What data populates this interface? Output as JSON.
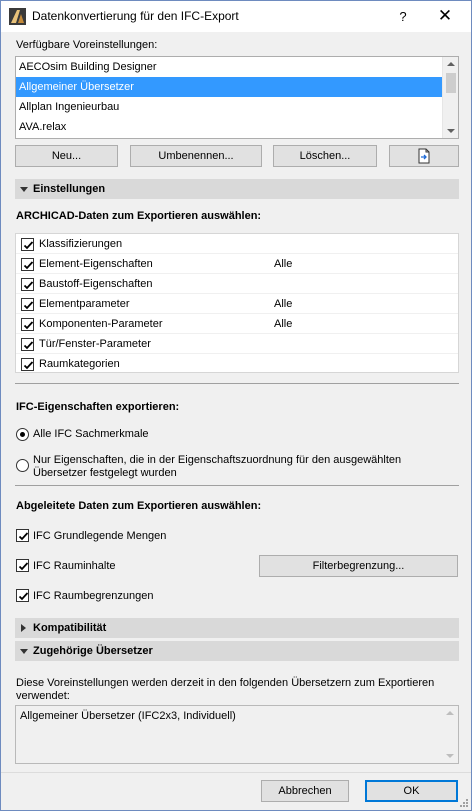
{
  "window": {
    "title": "Datenkonvertierung für den IFC-Export",
    "help_label": "?",
    "close_glyph": "✕"
  },
  "presets": {
    "label": "Verfügbare Voreinstellungen:",
    "items": [
      "AECOsim Building Designer",
      "Allgemeiner Übersetzer",
      "Allplan Ingenieurbau",
      "AVA.relax"
    ],
    "selected": "Allgemeiner Übersetzer",
    "buttons": {
      "new": "Neu...",
      "rename": "Umbenennen...",
      "delete": "Löschen..."
    }
  },
  "settings": {
    "title": "Einstellungen",
    "archicad_label": "ARCHICAD-Daten zum Exportieren auswählen:",
    "archicad_items": [
      {
        "label": "Klassifizierungen",
        "value": "",
        "checked": true
      },
      {
        "label": "Element-Eigenschaften",
        "value": "Alle",
        "checked": true
      },
      {
        "label": "Baustoff-Eigenschaften",
        "value": "",
        "checked": true
      },
      {
        "label": "Elementparameter",
        "value": "Alle",
        "checked": true
      },
      {
        "label": "Komponenten-Parameter",
        "value": "Alle",
        "checked": true
      },
      {
        "label": "Tür/Fenster-Parameter",
        "value": "",
        "checked": true
      },
      {
        "label": "Raumkategorien",
        "value": "",
        "checked": true
      }
    ],
    "ifc_props_label": "IFC-Eigenschaften exportieren:",
    "radio_all": "Alle IFC Sachmerkmale",
    "radio_only_line1": "Nur Eigenschaften, die in der Eigenschaftszuordnung für den ausgewählten",
    "radio_only_line2": "Übersetzer festgelegt wurden",
    "derived_label": "Abgeleitete Daten zum Exportieren auswählen:",
    "derived_items": [
      {
        "label": "IFC Grundlegende Mengen",
        "checked": true
      },
      {
        "label": "IFC Rauminhalte",
        "checked": true
      },
      {
        "label": "IFC Raumbegrenzungen",
        "checked": true
      }
    ],
    "filter_button": "Filterbegrenzung..."
  },
  "compat": {
    "title": "Kompatibilität"
  },
  "translators": {
    "title": "Zugehörige Übersetzer",
    "desc_line1": "Diese Voreinstellungen werden derzeit in den folgenden Übersetzern zum Exportieren",
    "desc_line2": "verwendet:",
    "list_text": "Allgemeiner Übersetzer (IFC2x3, Individuell)"
  },
  "footer": {
    "cancel": "Abbrechen",
    "ok": "OK"
  },
  "colors": {
    "selection": "#3399ff",
    "section_header": "#d9d9d9",
    "primary_border": "#0078d7"
  }
}
